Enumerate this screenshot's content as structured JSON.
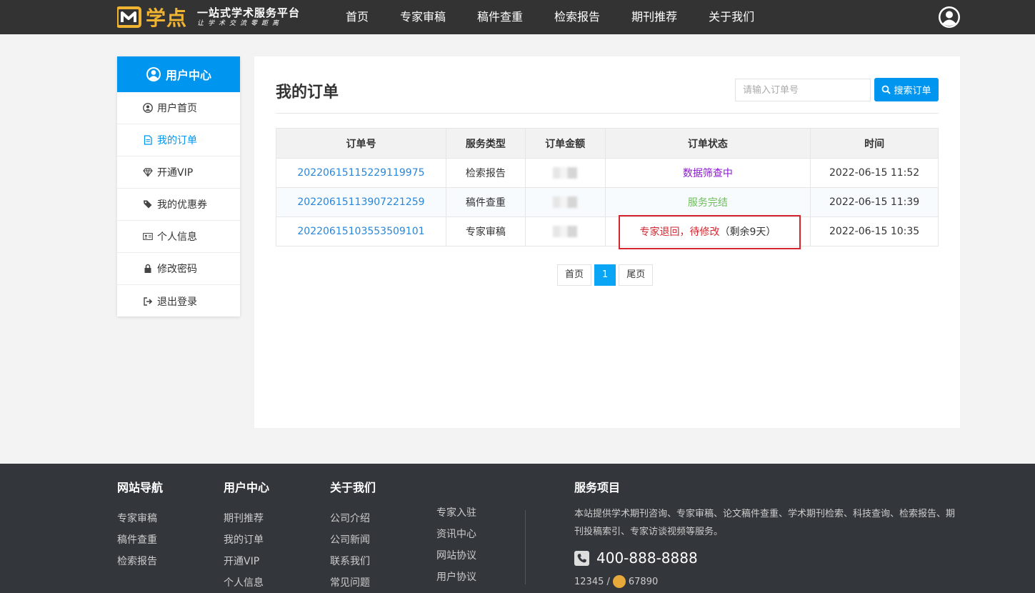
{
  "header": {
    "logo_name": "学点",
    "logo_tagline": "一站式学术服务平台",
    "logo_slogan": "让学术交流零距离",
    "nav": [
      "首页",
      "专家审稿",
      "稿件查重",
      "检索报告",
      "期刊推荐",
      "关于我们"
    ],
    "avatar_icon": "user-circle-icon"
  },
  "sidebar": {
    "title": "用户中心",
    "items": [
      {
        "label": "用户首页",
        "icon": "user-circle-icon"
      },
      {
        "label": "我的订单",
        "icon": "document-icon"
      },
      {
        "label": "开通VIP",
        "icon": "diamond-icon"
      },
      {
        "label": "我的优惠券",
        "icon": "tags-icon"
      },
      {
        "label": "个人信息",
        "icon": "id-card-icon"
      },
      {
        "label": "修改密码",
        "icon": "lock-icon"
      },
      {
        "label": "退出登录",
        "icon": "sign-out-icon"
      }
    ],
    "active_index": 1
  },
  "main": {
    "title": "我的订单",
    "search_placeholder": "请输入订单号",
    "search_button": "搜索订单",
    "columns": [
      "订单号",
      "服务类型",
      "订单金额",
      "订单状态",
      "时间"
    ],
    "rows": [
      {
        "order_no": "20220615115229119975",
        "service": "检索报告",
        "status": "数据筛查中",
        "status_extra": "",
        "time": "2022-06-15 11:52"
      },
      {
        "order_no": "20220615113907221259",
        "service": "稿件查重",
        "status": "服务完结",
        "status_extra": "",
        "time": "2022-06-15 11:39"
      },
      {
        "order_no": "20220615103553509101",
        "service": "专家审稿",
        "status": "专家退回，待修改",
        "status_extra": "（剩余9天）",
        "time": "2022-06-15 10:35"
      }
    ],
    "pager": {
      "first": "首页",
      "current": "1",
      "last": "尾页"
    }
  },
  "footer": {
    "nav_title": "网站导航",
    "nav_links": [
      "专家审稿",
      "稿件查重",
      "检索报告"
    ],
    "user_title": "用户中心",
    "user_links": [
      "期刊推荐",
      "我的订单",
      "开通VIP",
      "个人信息"
    ],
    "about_title": "关于我们",
    "about_links": [
      "公司介绍",
      "公司新闻",
      "联系我们",
      "常见问题"
    ],
    "more_links": [
      "专家入驻",
      "资讯中心",
      "网站协议",
      "用户协议"
    ],
    "service_title": "服务项目",
    "service_desc": "本站提供学术期刊咨询、专家审稿、论文稿件查重、学术期刊检索、科技查询、检索报告、期刊投稿索引、专家访谈视频等服务。",
    "phone": "400-888-8888",
    "beian_left": "12345 /",
    "beian_right": "67890"
  },
  "colors": {
    "brand": "#0096f0",
    "status_processing": "#8b19d0",
    "status_done": "#6dbd5a",
    "status_returned": "#d5262f",
    "logo_gold": "#f0b432"
  }
}
